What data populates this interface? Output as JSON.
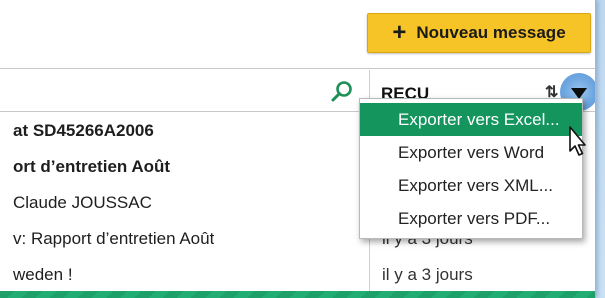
{
  "toolbar": {
    "new_message_label": "Nouveau message",
    "new_message_icon": "plus-icon",
    "accent_color": "#f6c427"
  },
  "list_header": {
    "search_icon": "search-icon",
    "column_label": "REÇU",
    "sort_icon": "sort-icon",
    "menu_icon": "caret-down-icon"
  },
  "messages": [
    {
      "subject": "at SD45266A2006",
      "date": "",
      "unread": true
    },
    {
      "subject": "ort d’entretien Août",
      "date": "",
      "unread": true
    },
    {
      "subject": "Claude JOUSSAC",
      "date": "",
      "unread": false
    },
    {
      "subject": "v: Rapport d’entretien Août",
      "date": "il y a 3 jours",
      "unread": false
    },
    {
      "subject": "weden !",
      "date": "il y a 3 jours",
      "unread": false
    }
  ],
  "export_menu": {
    "items": [
      {
        "label": "Exporter vers Excel...",
        "highlighted": true
      },
      {
        "label": "Exporter vers Word",
        "highlighted": false
      },
      {
        "label": "Exporter vers XML...",
        "highlighted": false
      },
      {
        "label": "Exporter vers PDF...",
        "highlighted": false
      }
    ],
    "highlight_color": "#15955e"
  },
  "colors": {
    "selected_row_green": "#1ea06b",
    "background_blue": "#c9e1f5"
  }
}
